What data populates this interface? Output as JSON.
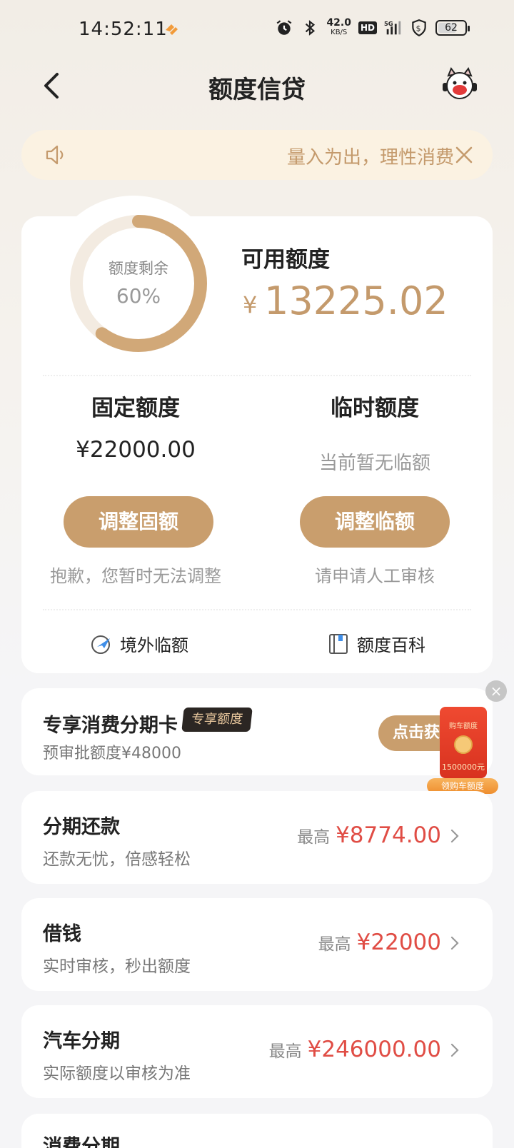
{
  "status": {
    "time": "14:52:11",
    "net_speed_value": "42.0",
    "net_speed_unit": "KB/S",
    "hd": "HD",
    "signal": "5G",
    "battery": "62"
  },
  "header": {
    "title": "额度信贷"
  },
  "notice": {
    "text": "量入为出，理性消费"
  },
  "credit": {
    "ring_label": "额度剩余",
    "ring_value": "60%",
    "ring_fraction": 0.6,
    "available_label": "可用额度",
    "currency": "¥",
    "available_amount": "13225.02",
    "fixed": {
      "title": "固定额度",
      "value": "¥22000.00",
      "button": "调整固额",
      "note": "抱歉，您暂时无法调整"
    },
    "temporary": {
      "title": "临时额度",
      "value": "当前暂无临额",
      "button": "调整临额",
      "note": "请申请人工审核"
    },
    "links": {
      "overseas": "境外临额",
      "wiki": "额度百科"
    }
  },
  "exclusive": {
    "title": "专享消费分期卡",
    "badge": "专享额度",
    "sub": "预审批额度¥48000",
    "button": "点击获"
  },
  "promo": {
    "top": "购车额度",
    "amount": "1500000元",
    "label": "领购车额度"
  },
  "products": [
    {
      "title": "分期还款",
      "sub": "还款无忧，倍感轻松",
      "prefix": "最高",
      "amount": "¥8774.00"
    },
    {
      "title": "借钱",
      "sub": "实时审核，秒出额度",
      "prefix": "最高",
      "amount": "¥22000"
    },
    {
      "title": "汽车分期",
      "sub": "实际额度以审核为准",
      "prefix": "最高",
      "amount": "¥246000.00"
    }
  ],
  "partial": {
    "title": "消费分期"
  },
  "colors": {
    "accent": "#c99e6d",
    "gold_text": "#c49a6c",
    "red": "#e04d45"
  }
}
